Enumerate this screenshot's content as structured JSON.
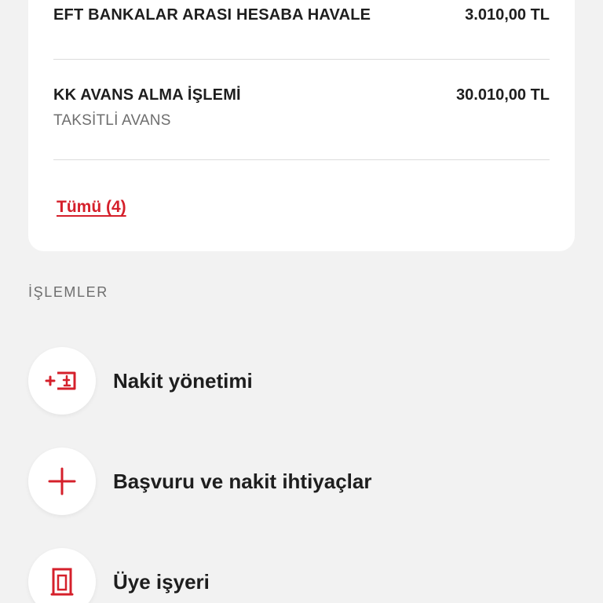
{
  "transactions": [
    {
      "title": "EFT BANKALAR ARASI HESABA HAVALE",
      "amount": "3.010,00 TL",
      "subtitle": ""
    },
    {
      "title": "KK AVANS ALMA İŞLEMİ",
      "amount": "30.010,00 TL",
      "subtitle": "TAKSİTLİ AVANS"
    }
  ],
  "all_link_label": "Tümü (4)",
  "section_title": "İŞLEMLER",
  "actions": [
    {
      "label": "Nakit yönetimi",
      "icon": "cash-transfer-icon"
    },
    {
      "label": "Başvuru ve nakit ihtiyaçlar",
      "icon": "plus-icon"
    },
    {
      "label": "Üye işyeri",
      "icon": "merchant-icon"
    }
  ],
  "colors": {
    "accent": "#d5202b",
    "background": "#f2f2f2",
    "card": "#ffffff",
    "text": "#1e1e1e",
    "muted": "#6e6e6e"
  }
}
